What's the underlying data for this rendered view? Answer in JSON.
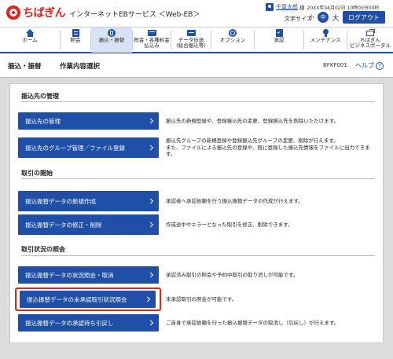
{
  "header": {
    "logo_text": "ちばぎん",
    "service_name": "インターネットEBサービス ＜Web-EB＞",
    "user_name": "千葉太郎",
    "user_suffix": "様",
    "last_login": "20XX年04月02日 10時00分00秒",
    "font_size_label": "文字サイズ",
    "font_small": "小",
    "font_medium": "中",
    "font_large": "大",
    "logout_label": "ログアウト"
  },
  "nav": {
    "items": [
      {
        "label": "ホーム",
        "icon": "home-icon"
      },
      {
        "label": "照会",
        "icon": "inquiry-icon"
      },
      {
        "label": "振込・振替",
        "icon": "transfer-icon"
      },
      {
        "label": "税金・各種料金\n払込み",
        "icon": "tax-payment-icon"
      },
      {
        "label": "データ伝送\n(総合振込等)",
        "icon": "data-transfer-icon"
      },
      {
        "label": "オプション",
        "icon": "option-icon"
      },
      {
        "label": "承認",
        "icon": "approval-icon"
      },
      {
        "label": "メンテナンス",
        "icon": "maintenance-icon"
      },
      {
        "label": "ちばぎん\nビジネスポータル",
        "icon": "portal-icon"
      }
    ]
  },
  "titlebar": {
    "crumb": "振込・振替",
    "subtitle": "作業内容選択",
    "screen_id": "BFKF001",
    "help_label": "ヘルプ",
    "help_icon": "?"
  },
  "sections": [
    {
      "title": "振込先の管理",
      "actions": [
        {
          "label": "振込先の管理",
          "desc": "振込先の新規登録や、登録振込先の変更、登録振込先を削除いただけます。"
        },
        {
          "label": "振込先のグループ管理／ファイル登録",
          "desc": "振込先グループの新規登録や登録振込先グループの変更、削除が行えます。\nまた、ファイルによる振込先の登録や、既に登録した振込先情報をファイルに出力できます。"
        }
      ]
    },
    {
      "title": "取引の開始",
      "actions": [
        {
          "label": "振込振替データの新規作成",
          "desc": "承認者へ承認依頼を行う振込振替データの作成が行えます。"
        },
        {
          "label": "振込振替データの修正・削除",
          "desc": "作成途中やエラーとなった取引を修正、削除できます。"
        }
      ]
    },
    {
      "title": "取引状況の照会",
      "actions": [
        {
          "label": "振込振替データの状況照会・取消",
          "desc": "承認済み取引の照会や予約中取引の取り消しが可能です。"
        },
        {
          "label": "振込振替データの未承認取引状況照会",
          "desc": "未承認取引の照会が可能です。"
        },
        {
          "label": "振込振替データの承認待ち引戻し",
          "desc": "ご自身で承認依頼を行った振込振替データの取消し（引戻し）が行えます。"
        }
      ]
    }
  ]
}
